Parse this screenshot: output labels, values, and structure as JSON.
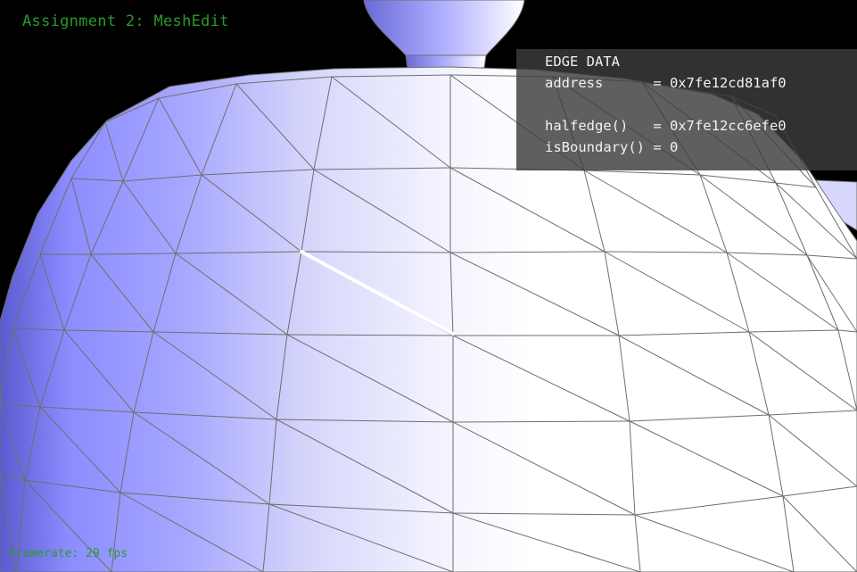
{
  "app": {
    "title": "Assignment 2: MeshEdit",
    "framerate_text": "Framerate: 29 fps"
  },
  "edge_panel": {
    "heading": "EDGE DATA",
    "address_line": "address      = 0x7fe12cd81af0",
    "blank_line": "",
    "halfedge_line": "halfedge()   = 0x7fe12cc6efe0",
    "boundary_line": "isBoundary() = 0"
  },
  "colors": {
    "background": "#000000",
    "overlay_text": "#2a9a2a",
    "panel_text": "#f2f2f2",
    "mesh_fill_light": "#ffffff",
    "mesh_fill_blue": "#8c8cff",
    "wireframe": "#6e6e6e",
    "selected_edge": "#ffffff"
  }
}
